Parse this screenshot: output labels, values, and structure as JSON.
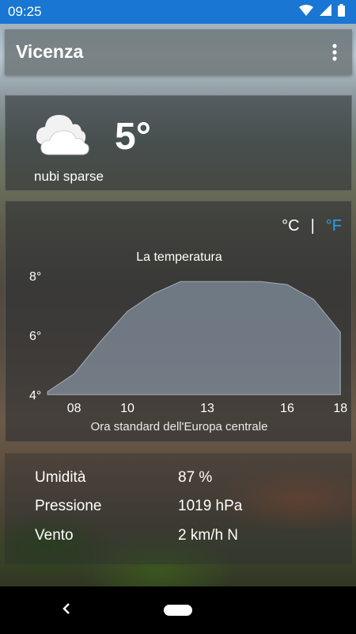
{
  "status_bar": {
    "time": "09:25"
  },
  "app_bar": {
    "title": "Vicenza"
  },
  "current": {
    "temperature": "5°",
    "condition": "nubi sparse",
    "icon": "cloud-icon"
  },
  "units": {
    "celsius": "°C",
    "separator": "|",
    "fahrenheit": "°F",
    "active_color": "#2aa3e8"
  },
  "chart_data": {
    "type": "area",
    "title": "La temperatura",
    "xlabel": "Ora standard dell'Europa centrale",
    "x_ticks": [
      "08",
      "10",
      "13",
      "16",
      "18"
    ],
    "y_ticks": [
      "8°",
      "6°",
      "4°"
    ],
    "ylim": [
      4,
      8.5
    ],
    "x": [
      7,
      8,
      9,
      10,
      11,
      12,
      13,
      14,
      15,
      16,
      17,
      18
    ],
    "values": [
      4.1,
      4.7,
      5.8,
      6.8,
      7.4,
      7.8,
      7.8,
      7.8,
      7.8,
      7.7,
      7.2,
      6.1
    ]
  },
  "details": {
    "humidity_label": "Umidità",
    "humidity_value": "87 %",
    "pressure_label": "Pressione",
    "pressure_value": "1019 hPa",
    "wind_label": "Vento",
    "wind_value": "2 km/h N"
  }
}
